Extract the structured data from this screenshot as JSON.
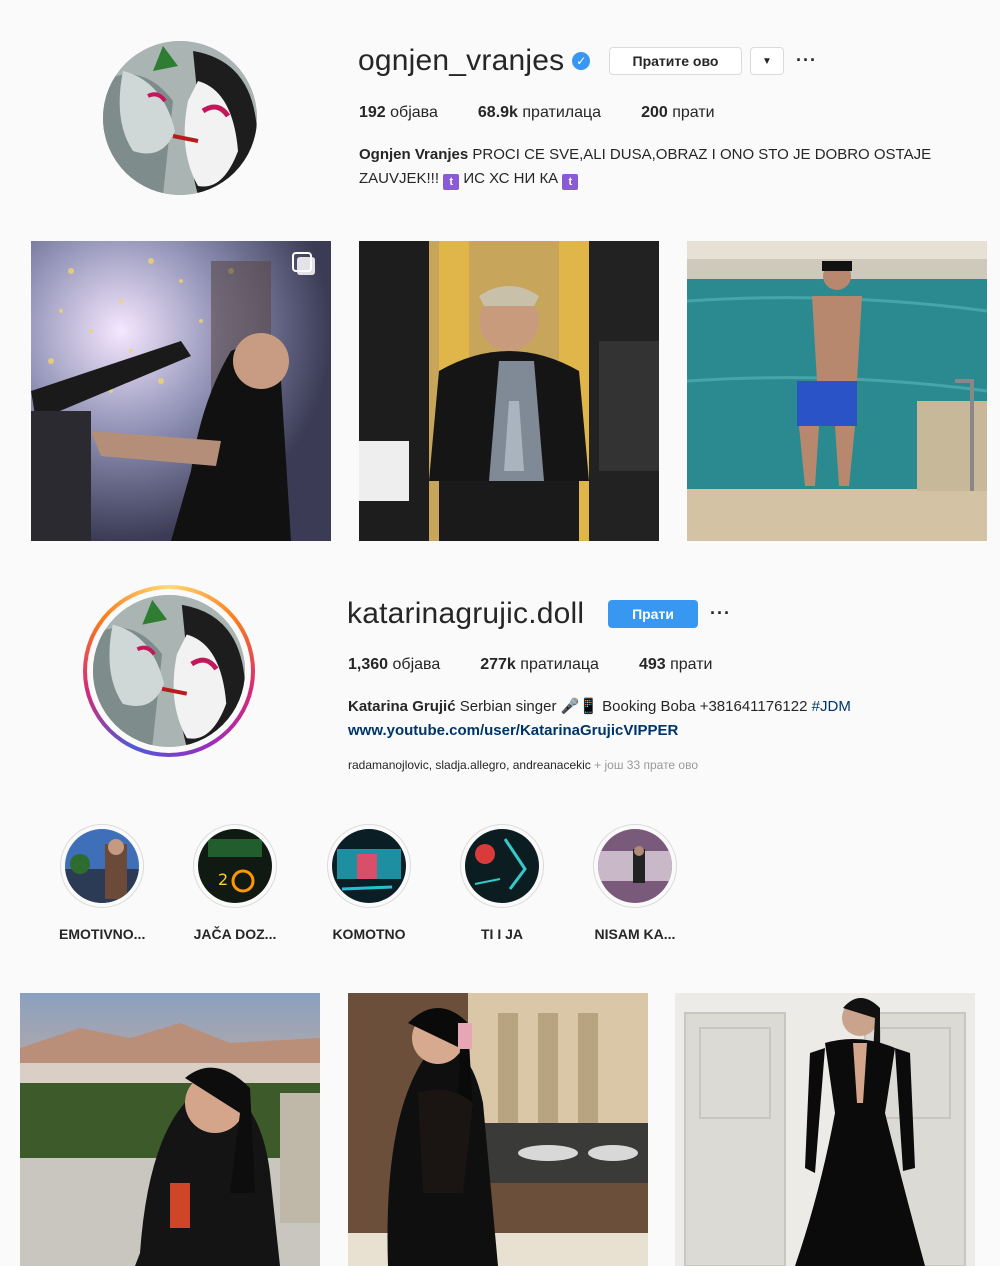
{
  "profile1": {
    "username": "ognjen_vranjes",
    "follow_label": "Пратите ово",
    "dropdown_icon": "chevron-down-icon",
    "more_icon": "more-options-icon",
    "stats": {
      "posts_value": "192",
      "posts_label": "објава",
      "followers_value": "68.9k",
      "followers_label": "пратилаца",
      "following_value": "200",
      "following_label": "прати"
    },
    "full_name": "Ognjen Vranjes",
    "bio_line1": "PROCI CE SVE,ALI DUSA,OBRAZ I ONO STO JE DOBRO OSTAJE",
    "bio_line2_a": "ZAUVJEK!!!",
    "bio_line2_b": "ИС ХС НИ КА",
    "emoji": "t"
  },
  "profile2": {
    "username": "katarinagrujic.doll",
    "follow_label": "Прати",
    "more_icon": "more-options-icon",
    "stats": {
      "posts_value": "1,360",
      "posts_label": "објава",
      "followers_value": "277k",
      "followers_label": "пратилаца",
      "following_value": "493",
      "following_label": "прати"
    },
    "full_name": "Katarina Grujić",
    "bio_text": "Serbian singer 🎤📱 Booking Boba +381641176122",
    "hashtag": "#JDM",
    "link": "www.youtube.com/user/KatarinaGrujicVIPPER",
    "followed_by": "radamanojlovic, sladja.allegro, andreanacekic",
    "followed_by_more": "+ још 33 прате ово",
    "highlights": [
      {
        "label": "EMOTIVNO..."
      },
      {
        "label": "JAČA DOZ..."
      },
      {
        "label": "KOMOTNO"
      },
      {
        "label": "TI I JA"
      },
      {
        "label": "NISAM KA..."
      }
    ]
  },
  "colors": {
    "accent": "#3897f0",
    "text": "#262626",
    "link": "#003569",
    "background": "#fafafa"
  }
}
